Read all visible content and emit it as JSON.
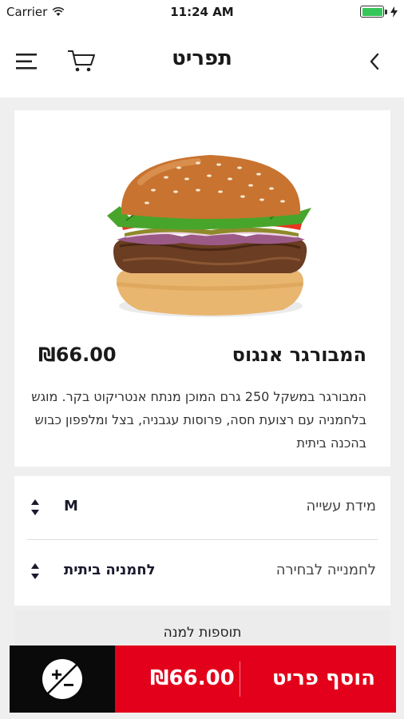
{
  "status_bar": {
    "carrier": "Carrier",
    "time": "11:24 AM"
  },
  "nav": {
    "title": "תפריט"
  },
  "product": {
    "name": "המבורגר אנגוס",
    "price": "₪66.00",
    "description": "המבורגר במשקל 250 גרם המוכן מנתח אנטריקוט בקר. מוגש בלחמניה עם רצועת חסה, פרוסות עגבניה, בצל ומלפפון כבוש בהכנה ביתית"
  },
  "options": [
    {
      "label": "מידת עשייה",
      "value": "M"
    },
    {
      "label": "לחמנייה לבחירה",
      "value": "לחמניה ביתית"
    }
  ],
  "extras": {
    "label": "תוספות למנה"
  },
  "add_button": {
    "label": "הוסף פריט",
    "price": "₪66.00"
  },
  "colors": {
    "accent": "#e3001b",
    "dark": "#0a0a0a",
    "battery": "#35c759"
  }
}
